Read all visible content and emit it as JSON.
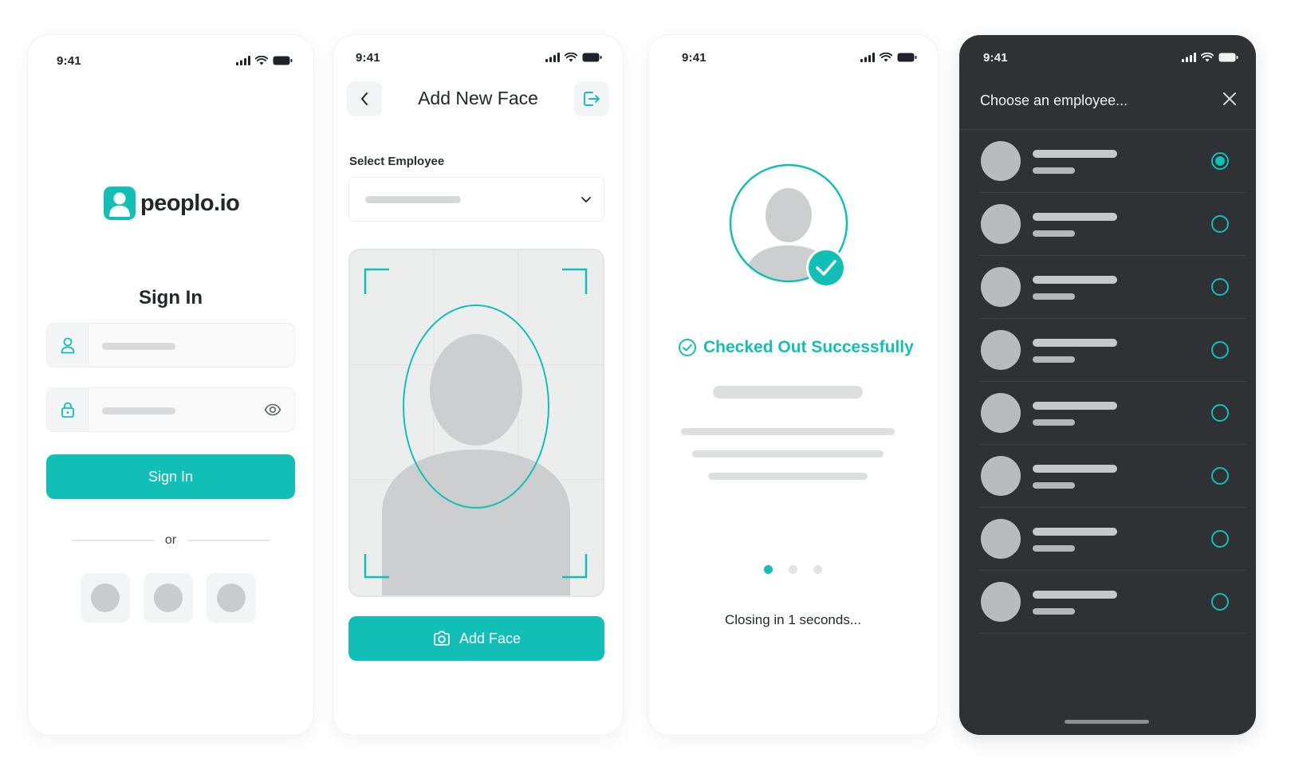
{
  "colors": {
    "accent": "#12bfb7",
    "dark_bg": "#2f3235"
  },
  "status_bar": {
    "time": "9:41"
  },
  "sign_in": {
    "logo_text": "peoplo.io",
    "title": "Sign In",
    "button_label": "Sign In",
    "divider_text": "or",
    "username_icon": "user-icon",
    "password_icon": "lock-icon",
    "reveal_icon": "eye-icon"
  },
  "add_face": {
    "title": "Add New Face",
    "select_label": "Select Employee",
    "button_label": "Add Face",
    "back_icon": "chevron-left-icon",
    "exit_icon": "logout-icon"
  },
  "checkout": {
    "message": "Checked Out Successfully",
    "closing_text": "Closing in 1 seconds...",
    "pager": {
      "count": 3,
      "active": 0
    }
  },
  "employee_picker": {
    "title": "Choose an employee...",
    "close_icon": "close-icon",
    "rows": 8,
    "selected_index": 0
  }
}
